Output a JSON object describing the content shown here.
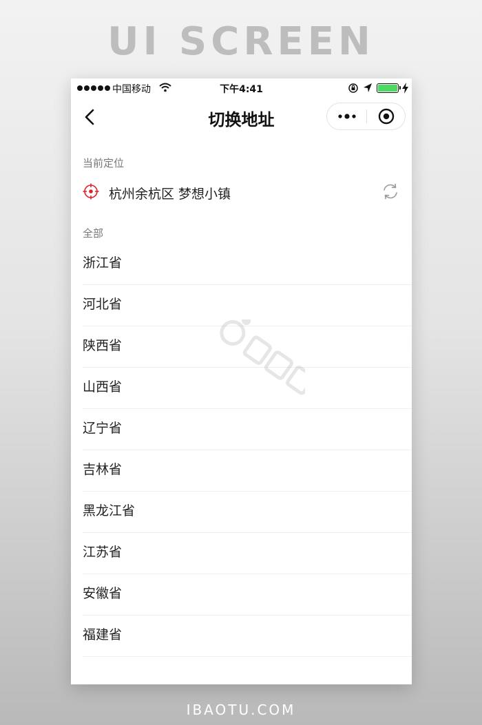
{
  "poster": {
    "title": "UI SCREEN",
    "footer": "IBAOTU.COM"
  },
  "status_bar": {
    "carrier": "中国移动",
    "time": "下午4:41"
  },
  "nav": {
    "title": "切换地址"
  },
  "current_location": {
    "label": "当前定位",
    "value": "杭州余杭区 梦想小镇"
  },
  "all": {
    "label": "全部",
    "provinces": [
      "浙江省",
      "河北省",
      "陕西省",
      "山西省",
      "辽宁省",
      "吉林省",
      "黑龙江省",
      "江苏省",
      "安徽省",
      "福建省"
    ]
  },
  "colors": {
    "accent": "#e0202a",
    "battery": "#4cd964"
  }
}
